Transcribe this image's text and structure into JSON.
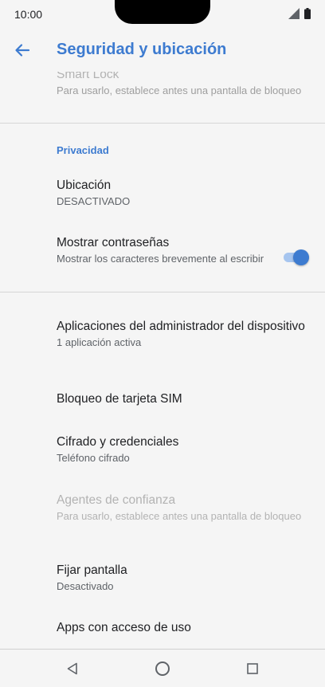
{
  "status_bar": {
    "time": "10:00"
  },
  "app_bar": {
    "title": "Seguridad y ubicación"
  },
  "items": {
    "smart_lock": {
      "title": "Smart Lock",
      "subtitle": "Para usarlo, establece antes una pantalla de bloqueo"
    },
    "privacy_header": "Privacidad",
    "location": {
      "title": "Ubicación",
      "subtitle": "DESACTIVADO"
    },
    "show_passwords": {
      "title": "Mostrar contraseñas",
      "subtitle": "Mostrar los caracteres brevemente al escribir",
      "toggle_on": true
    },
    "device_admin": {
      "title": "Aplicaciones del administrador del dispositivo",
      "subtitle": "1 aplicación activa"
    },
    "sim_lock": {
      "title": "Bloqueo de tarjeta SIM"
    },
    "encryption": {
      "title": "Cifrado y credenciales",
      "subtitle": "Teléfono cifrado"
    },
    "trust_agents": {
      "title": "Agentes de confianza",
      "subtitle": "Para usarlo, establece antes una pantalla de bloqueo"
    },
    "screen_pinning": {
      "title": "Fijar pantalla",
      "subtitle": "Desactivado"
    },
    "usage_access": {
      "title": "Apps con acceso de uso"
    }
  },
  "colors": {
    "accent": "#3d7bd0",
    "background": "#f5f5f5",
    "toggle_track": "#a6c5ef",
    "disabled_text": "#b3b3b3"
  },
  "icons": {
    "back": "arrow-left-icon",
    "signal": "cell-signal-icon",
    "battery": "battery-icon",
    "nav_back": "triangle-back-icon",
    "nav_home": "circle-home-icon",
    "nav_recents": "square-recents-icon"
  }
}
